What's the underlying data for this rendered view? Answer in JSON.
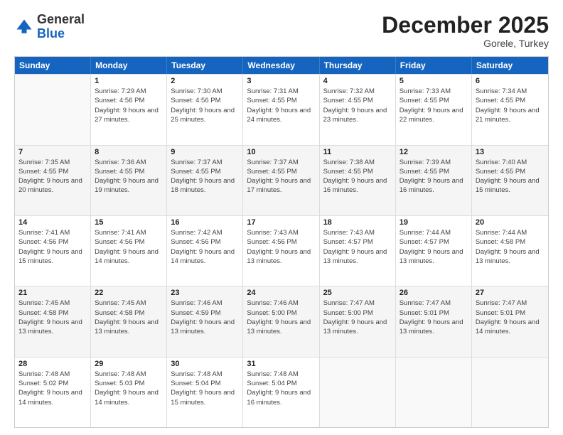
{
  "logo": {
    "general": "General",
    "blue": "Blue"
  },
  "header": {
    "month": "December 2025",
    "location": "Gorele, Turkey"
  },
  "days_of_week": [
    "Sunday",
    "Monday",
    "Tuesday",
    "Wednesday",
    "Thursday",
    "Friday",
    "Saturday"
  ],
  "rows": [
    [
      {
        "day": "",
        "sunrise": "",
        "sunset": "",
        "daylight": "",
        "empty": true
      },
      {
        "day": "1",
        "sunrise": "Sunrise: 7:29 AM",
        "sunset": "Sunset: 4:56 PM",
        "daylight": "Daylight: 9 hours and 27 minutes."
      },
      {
        "day": "2",
        "sunrise": "Sunrise: 7:30 AM",
        "sunset": "Sunset: 4:56 PM",
        "daylight": "Daylight: 9 hours and 25 minutes."
      },
      {
        "day": "3",
        "sunrise": "Sunrise: 7:31 AM",
        "sunset": "Sunset: 4:55 PM",
        "daylight": "Daylight: 9 hours and 24 minutes."
      },
      {
        "day": "4",
        "sunrise": "Sunrise: 7:32 AM",
        "sunset": "Sunset: 4:55 PM",
        "daylight": "Daylight: 9 hours and 23 minutes."
      },
      {
        "day": "5",
        "sunrise": "Sunrise: 7:33 AM",
        "sunset": "Sunset: 4:55 PM",
        "daylight": "Daylight: 9 hours and 22 minutes."
      },
      {
        "day": "6",
        "sunrise": "Sunrise: 7:34 AM",
        "sunset": "Sunset: 4:55 PM",
        "daylight": "Daylight: 9 hours and 21 minutes."
      }
    ],
    [
      {
        "day": "7",
        "sunrise": "Sunrise: 7:35 AM",
        "sunset": "Sunset: 4:55 PM",
        "daylight": "Daylight: 9 hours and 20 minutes."
      },
      {
        "day": "8",
        "sunrise": "Sunrise: 7:36 AM",
        "sunset": "Sunset: 4:55 PM",
        "daylight": "Daylight: 9 hours and 19 minutes."
      },
      {
        "day": "9",
        "sunrise": "Sunrise: 7:37 AM",
        "sunset": "Sunset: 4:55 PM",
        "daylight": "Daylight: 9 hours and 18 minutes."
      },
      {
        "day": "10",
        "sunrise": "Sunrise: 7:37 AM",
        "sunset": "Sunset: 4:55 PM",
        "daylight": "Daylight: 9 hours and 17 minutes."
      },
      {
        "day": "11",
        "sunrise": "Sunrise: 7:38 AM",
        "sunset": "Sunset: 4:55 PM",
        "daylight": "Daylight: 9 hours and 16 minutes."
      },
      {
        "day": "12",
        "sunrise": "Sunrise: 7:39 AM",
        "sunset": "Sunset: 4:55 PM",
        "daylight": "Daylight: 9 hours and 16 minutes."
      },
      {
        "day": "13",
        "sunrise": "Sunrise: 7:40 AM",
        "sunset": "Sunset: 4:55 PM",
        "daylight": "Daylight: 9 hours and 15 minutes."
      }
    ],
    [
      {
        "day": "14",
        "sunrise": "Sunrise: 7:41 AM",
        "sunset": "Sunset: 4:56 PM",
        "daylight": "Daylight: 9 hours and 15 minutes."
      },
      {
        "day": "15",
        "sunrise": "Sunrise: 7:41 AM",
        "sunset": "Sunset: 4:56 PM",
        "daylight": "Daylight: 9 hours and 14 minutes."
      },
      {
        "day": "16",
        "sunrise": "Sunrise: 7:42 AM",
        "sunset": "Sunset: 4:56 PM",
        "daylight": "Daylight: 9 hours and 14 minutes."
      },
      {
        "day": "17",
        "sunrise": "Sunrise: 7:43 AM",
        "sunset": "Sunset: 4:56 PM",
        "daylight": "Daylight: 9 hours and 13 minutes."
      },
      {
        "day": "18",
        "sunrise": "Sunrise: 7:43 AM",
        "sunset": "Sunset: 4:57 PM",
        "daylight": "Daylight: 9 hours and 13 minutes."
      },
      {
        "day": "19",
        "sunrise": "Sunrise: 7:44 AM",
        "sunset": "Sunset: 4:57 PM",
        "daylight": "Daylight: 9 hours and 13 minutes."
      },
      {
        "day": "20",
        "sunrise": "Sunrise: 7:44 AM",
        "sunset": "Sunset: 4:58 PM",
        "daylight": "Daylight: 9 hours and 13 minutes."
      }
    ],
    [
      {
        "day": "21",
        "sunrise": "Sunrise: 7:45 AM",
        "sunset": "Sunset: 4:58 PM",
        "daylight": "Daylight: 9 hours and 13 minutes."
      },
      {
        "day": "22",
        "sunrise": "Sunrise: 7:45 AM",
        "sunset": "Sunset: 4:58 PM",
        "daylight": "Daylight: 9 hours and 13 minutes."
      },
      {
        "day": "23",
        "sunrise": "Sunrise: 7:46 AM",
        "sunset": "Sunset: 4:59 PM",
        "daylight": "Daylight: 9 hours and 13 minutes."
      },
      {
        "day": "24",
        "sunrise": "Sunrise: 7:46 AM",
        "sunset": "Sunset: 5:00 PM",
        "daylight": "Daylight: 9 hours and 13 minutes."
      },
      {
        "day": "25",
        "sunrise": "Sunrise: 7:47 AM",
        "sunset": "Sunset: 5:00 PM",
        "daylight": "Daylight: 9 hours and 13 minutes."
      },
      {
        "day": "26",
        "sunrise": "Sunrise: 7:47 AM",
        "sunset": "Sunset: 5:01 PM",
        "daylight": "Daylight: 9 hours and 13 minutes."
      },
      {
        "day": "27",
        "sunrise": "Sunrise: 7:47 AM",
        "sunset": "Sunset: 5:01 PM",
        "daylight": "Daylight: 9 hours and 14 minutes."
      }
    ],
    [
      {
        "day": "28",
        "sunrise": "Sunrise: 7:48 AM",
        "sunset": "Sunset: 5:02 PM",
        "daylight": "Daylight: 9 hours and 14 minutes."
      },
      {
        "day": "29",
        "sunrise": "Sunrise: 7:48 AM",
        "sunset": "Sunset: 5:03 PM",
        "daylight": "Daylight: 9 hours and 14 minutes."
      },
      {
        "day": "30",
        "sunrise": "Sunrise: 7:48 AM",
        "sunset": "Sunset: 5:04 PM",
        "daylight": "Daylight: 9 hours and 15 minutes."
      },
      {
        "day": "31",
        "sunrise": "Sunrise: 7:48 AM",
        "sunset": "Sunset: 5:04 PM",
        "daylight": "Daylight: 9 hours and 16 minutes."
      },
      {
        "day": "",
        "sunrise": "",
        "sunset": "",
        "daylight": "",
        "empty": true
      },
      {
        "day": "",
        "sunrise": "",
        "sunset": "",
        "daylight": "",
        "empty": true
      },
      {
        "day": "",
        "sunrise": "",
        "sunset": "",
        "daylight": "",
        "empty": true
      }
    ]
  ]
}
